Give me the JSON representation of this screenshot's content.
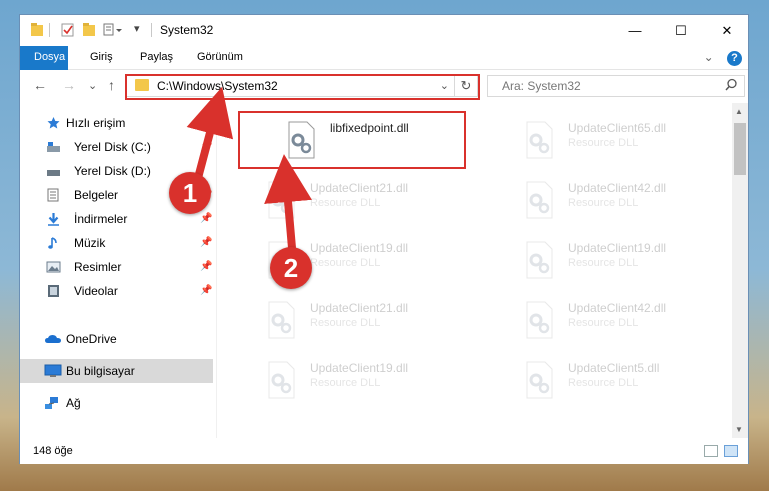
{
  "window": {
    "title": "System32",
    "minimize_glyph": "—",
    "maximize_glyph": "☐",
    "close_glyph": "✕"
  },
  "ribbon": {
    "tabs": [
      "Dosya",
      "Giriş",
      "Paylaş",
      "Görünüm"
    ],
    "collapse_glyph": "⌄",
    "help_glyph": "?"
  },
  "nav": {
    "back_glyph": "←",
    "forward_glyph": "→",
    "recent_glyph": "⌄",
    "up_glyph": "↑",
    "address": "C:\\Windows\\System32",
    "address_dropdown_glyph": "⌄",
    "refresh_glyph": "↻",
    "search_placeholder": "Ara: System32"
  },
  "sidebar": {
    "items": [
      {
        "label": "Hızlı erişim",
        "icon": "star-icon",
        "pinned": false
      },
      {
        "label": "Yerel Disk (C:)",
        "icon": "drive-icon",
        "pinned": true
      },
      {
        "label": "Yerel Disk (D:)",
        "icon": "drive-icon",
        "pinned": true
      },
      {
        "label": "Belgeler",
        "icon": "documents-icon",
        "pinned": true
      },
      {
        "label": "İndirmeler",
        "icon": "download-icon",
        "pinned": true
      },
      {
        "label": "Müzik",
        "icon": "music-icon",
        "pinned": true
      },
      {
        "label": "Resimler",
        "icon": "pictures-icon",
        "pinned": true
      },
      {
        "label": "Videolar",
        "icon": "videos-icon",
        "pinned": true
      },
      {
        "label": "OneDrive",
        "icon": "cloud-icon",
        "pinned": false
      },
      {
        "label": "Bu bilgisayar",
        "icon": "computer-icon",
        "pinned": false
      },
      {
        "label": "Ağ",
        "icon": "network-icon",
        "pinned": false
      }
    ],
    "pin_glyph": "📌"
  },
  "files": [
    {
      "name": "libfixedpoint.dll",
      "type": ""
    },
    {
      "name": "UpdateClient65.dll",
      "type": "Resource DLL"
    },
    {
      "name": "UpdateClient21.dll",
      "type": "Resource DLL"
    },
    {
      "name": "UpdateClient42.dll",
      "type": "Resource DLL"
    },
    {
      "name": "UpdateClient19.dll",
      "type": "Resource DLL"
    },
    {
      "name": "UpdateClient19.dll",
      "type": "Resource DLL"
    },
    {
      "name": "UpdateClient21.dll",
      "type": "Resource DLL"
    },
    {
      "name": "UpdateClient42.dll",
      "type": "Resource DLL"
    },
    {
      "name": "UpdateClient19.dll",
      "type": "Resource DLL"
    },
    {
      "name": "UpdateClient5.dll",
      "type": "Resource DLL"
    }
  ],
  "status": {
    "count": "148 öğe"
  },
  "callouts": [
    "1",
    "2"
  ],
  "colors": {
    "accent": "#1979ca",
    "highlight": "#d9312c",
    "folder": "#f3c74a"
  }
}
